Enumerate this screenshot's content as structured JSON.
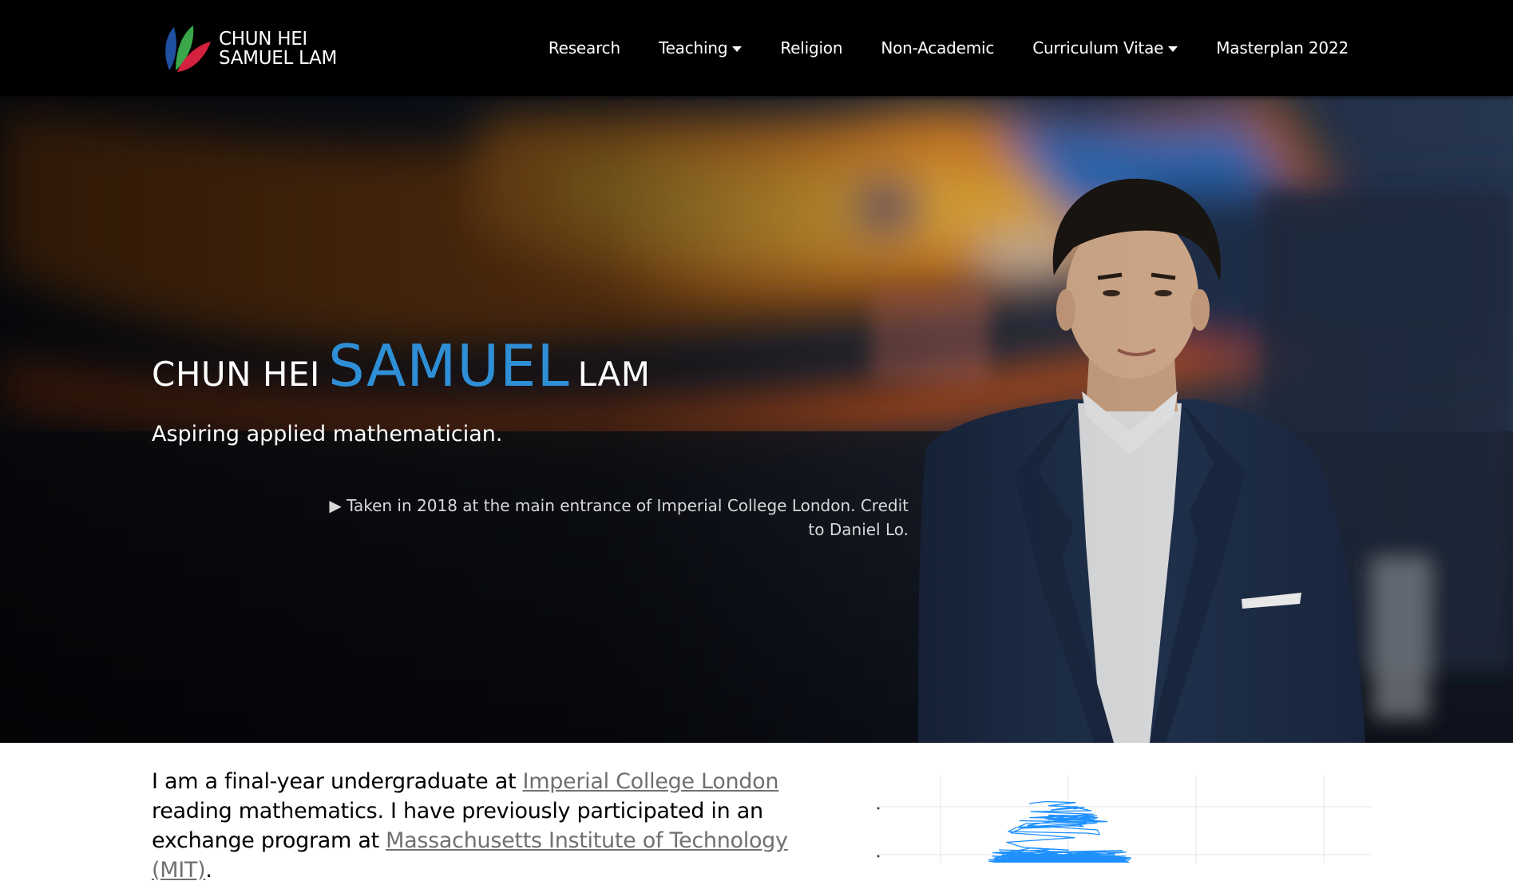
{
  "brand": {
    "line1": "CHUN HEI",
    "line2": "SAMUEL LAM",
    "logo_icon": "leaf-logo-icon",
    "logo_colors": [
      "#1f4fa0",
      "#3aa84a",
      "#d4213d"
    ]
  },
  "nav": {
    "items": [
      {
        "label": "Research",
        "dropdown": false
      },
      {
        "label": "Teaching",
        "dropdown": true
      },
      {
        "label": "Religion",
        "dropdown": false
      },
      {
        "label": "Non-Academic",
        "dropdown": false
      },
      {
        "label": "Curriculum Vitae",
        "dropdown": true
      },
      {
        "label": "Masterplan 2022",
        "dropdown": false
      }
    ]
  },
  "hero": {
    "title_prefix": "CHUN HEI",
    "title_highlight": "SAMUEL",
    "title_suffix": "LAM",
    "subtitle": "Aspiring applied mathematician.",
    "caption_marker": "▶",
    "caption": "Taken in 2018 at the main entrance of Imperial College London. Credit to Daniel Lo.",
    "accent_color": "#2f8fd6"
  },
  "intro": {
    "text1": "I am a final-year undergraduate at ",
    "link1": "Imperial College London",
    "text2": " reading mathematics. I have previously participated in an exchange program at ",
    "link2": "Massachusetts Institute of Technology (MIT)",
    "text3": "."
  },
  "colors": {
    "navbar_bg": "#000000",
    "link_gray": "#707070",
    "plot_blue": "#1e90ff"
  }
}
